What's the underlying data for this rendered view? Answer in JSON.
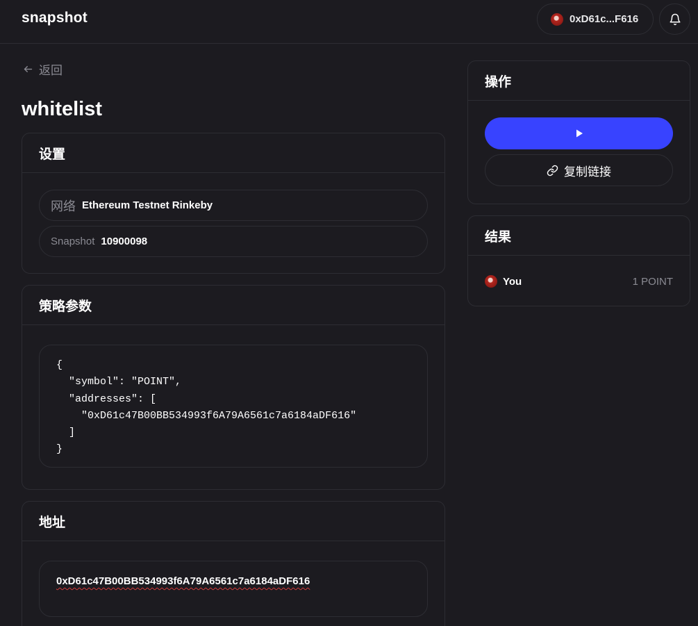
{
  "header": {
    "logo": "snapshot",
    "account": "0xD61c...F616"
  },
  "back": {
    "label": "返回"
  },
  "page": {
    "title": "whitelist"
  },
  "settings": {
    "title": "设置",
    "network_key": "网络",
    "network_value": "Ethereum Testnet Rinkeby",
    "snapshot_key": "Snapshot",
    "snapshot_value": "10900098"
  },
  "strategy": {
    "title": "策略参数",
    "code": "{\n  \"symbol\": \"POINT\",\n  \"addresses\": [\n    \"0xD61c47B00BB534993f6A79A6561c7a6184aDF616\"\n  ]\n}"
  },
  "addresses": {
    "title": "地址",
    "value": "0xD61c47B00BB534993f6A79A6561c7a6184aDF616"
  },
  "actions": {
    "title": "操作",
    "copy_label": "复制链接"
  },
  "results": {
    "title": "结果",
    "rows": [
      {
        "name": "You",
        "score": "1 POINT"
      }
    ]
  },
  "colors": {
    "background": "#1c1b20",
    "border": "#2d2d33",
    "primary": "#3843ff",
    "muted": "#8b8b93"
  },
  "icons": [
    "avatar",
    "bell-icon",
    "arrow-left-icon",
    "play-icon",
    "link-icon"
  ]
}
